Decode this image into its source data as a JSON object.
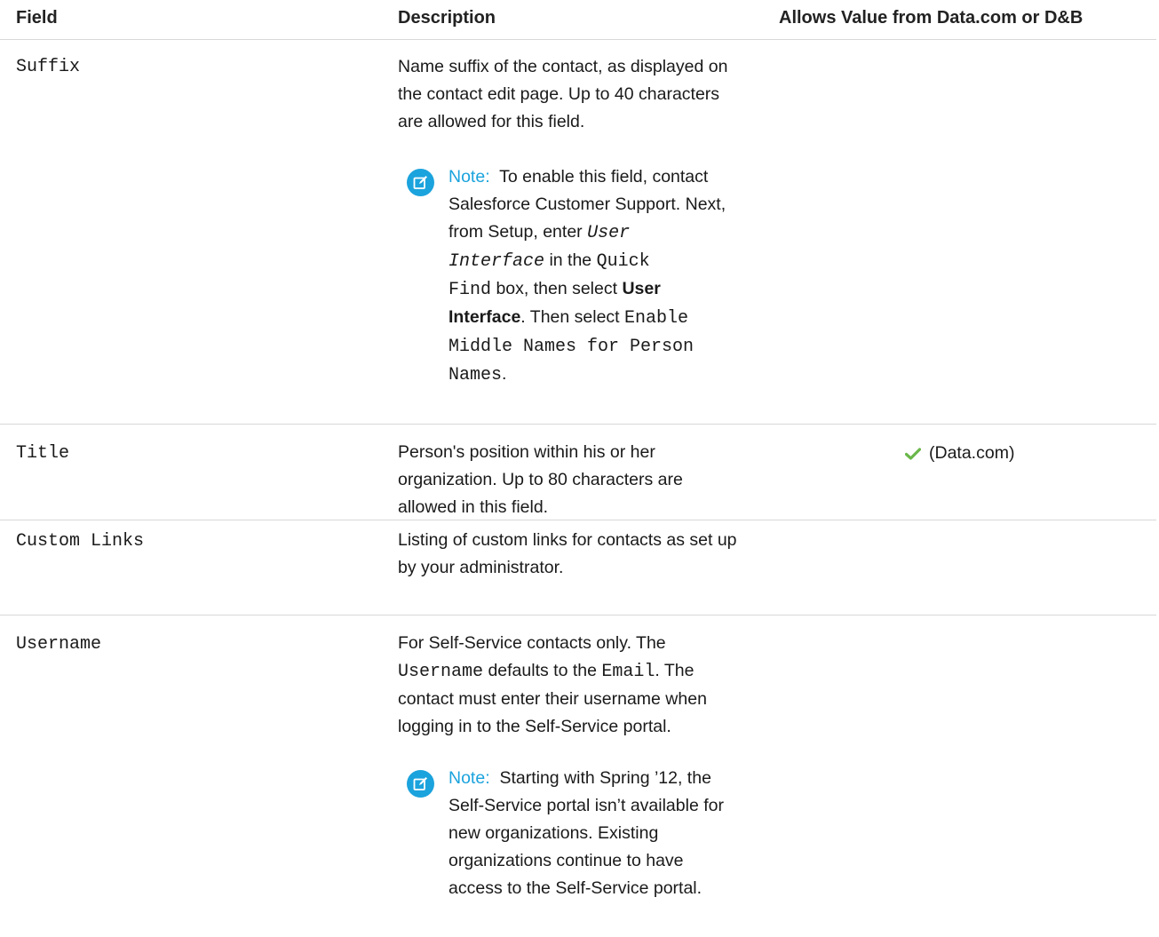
{
  "header": {
    "field": "Field",
    "description": "Description",
    "allows": "Allows Value from Data.com or D&B"
  },
  "rows": [
    {
      "field": "Suffix",
      "description_lines": [
        "Name suffix of the contact, as displayed on",
        "the contact edit page. Up to 40 characters",
        "are allowed for this field."
      ],
      "note": {
        "label": "Note:",
        "l1": "To enable this field, contact",
        "l2": "Salesforce Customer Support. Next,",
        "l3_text": "from Setup, enter",
        "l3_code": "User",
        "l4_code": "Interface",
        "l4_text": "in the",
        "l4_code2": "Quick",
        "l5_code": "Find",
        "l5_text": "box, then select",
        "l5_bold": "User",
        "l6_bold": "Interface",
        "l6_text": ". Then select",
        "l6_code": "Enable",
        "l7_code": "Middle Names for Person",
        "l8_code": "Names",
        "l8_text": "."
      }
    },
    {
      "field": "Title",
      "description_lines": [
        "Person's position within his or her",
        "organization. Up to 80 characters are",
        "allowed in this field."
      ],
      "allows": "(Data.com)"
    },
    {
      "field": "Custom Links",
      "description_lines": [
        "Listing of custom links for contacts as set up",
        "by your administrator."
      ]
    },
    {
      "field": "Username",
      "description": {
        "l1": "For Self-Service contacts only. The",
        "l2_code": "Username",
        "l2_text": "defaults to the",
        "l2_code2": "Email",
        "l2_text2": ". The",
        "l3": "contact must enter their username when",
        "l4": "logging in to the Self-Service portal."
      },
      "note": {
        "label": "Note:",
        "lines": [
          "Starting with Spring ’12, the",
          "Self-Service portal isn’t available for",
          "new organizations. Existing",
          "organizations continue to have",
          "access to the Self-Service portal."
        ]
      }
    }
  ],
  "colors": {
    "note_accent": "#1ba3dd",
    "check": "#6ab74a",
    "rule": "#d8d8d8"
  }
}
